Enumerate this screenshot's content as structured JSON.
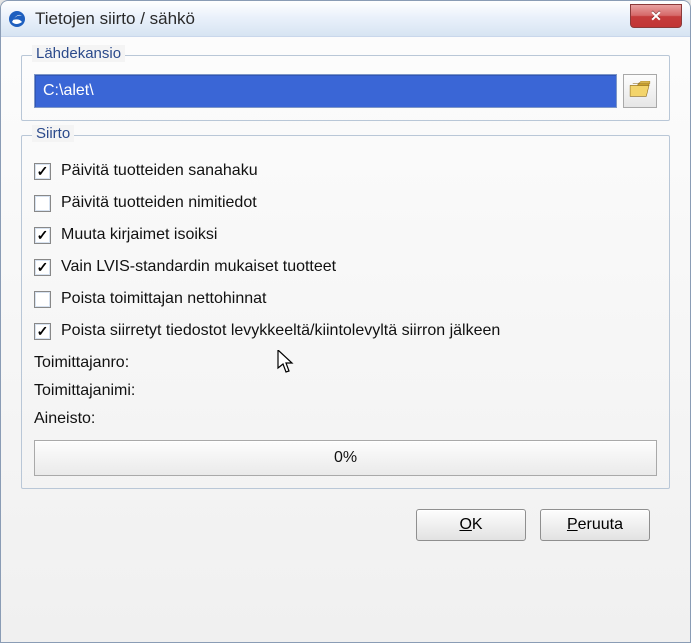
{
  "window": {
    "title": "Tietojen siirto / sähkö"
  },
  "source_group": {
    "legend": "Lähdekansio",
    "path_value": "C:\\alet\\"
  },
  "transfer_group": {
    "legend": "Siirto",
    "checks": [
      {
        "label": "Päivitä tuotteiden sanahaku",
        "checked": true
      },
      {
        "label": "Päivitä tuotteiden nimitiedot",
        "checked": false
      },
      {
        "label": "Muuta kirjaimet isoiksi",
        "checked": true
      },
      {
        "label": "Vain LVIS-standardin mukaiset tuotteet",
        "checked": true
      },
      {
        "label": "Poista toimittajan nettohinnat",
        "checked": false
      },
      {
        "label": "Poista siirretyt tiedostot levykkeeltä/kiintolevyltä siirron jälkeen",
        "checked": true
      }
    ],
    "info": {
      "supplier_no_label": "Toimittajanro:",
      "supplier_name_label": "Toimittajanimi:",
      "material_label": "Aineisto:"
    },
    "progress_text": "0%"
  },
  "buttons": {
    "ok": "OK",
    "cancel": "Peruuta",
    "ok_accelerator": "O",
    "cancel_accelerator": "P"
  }
}
